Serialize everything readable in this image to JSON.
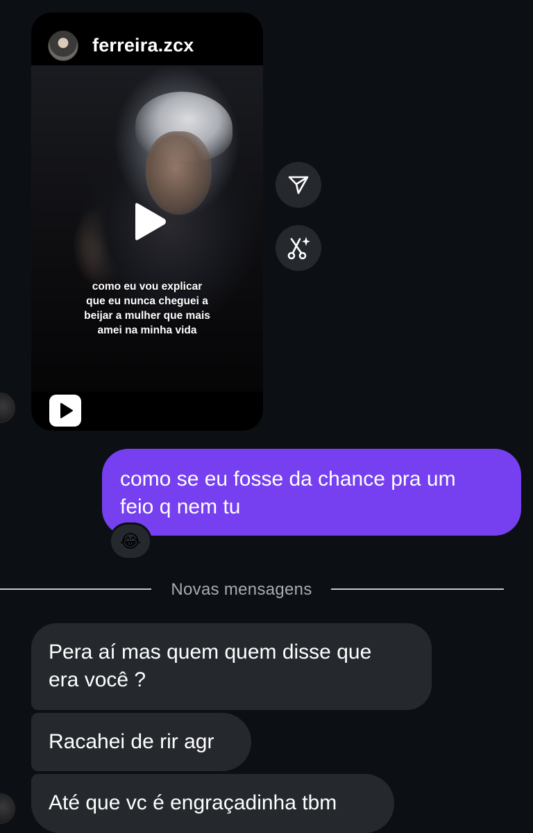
{
  "reel": {
    "username": "ferreira.zcx",
    "caption_lines": [
      "como eu vou explicar",
      "que eu nunca cheguei a",
      "beijar a mulher que mais",
      "amei na minha vida"
    ],
    "avatar_icon": "profile-photo",
    "play_icon": "play-icon",
    "reels_icon": "reels-icon"
  },
  "actions": {
    "share_icon": "send-icon",
    "remix_icon": "scissors-sparkle-icon"
  },
  "sent_message": {
    "lines": [
      "como se eu fosse da chance pra um",
      "feio q nem tu"
    ],
    "reaction": "😂",
    "color": "#7640f0"
  },
  "divider": {
    "label": "Novas mensagens"
  },
  "received_messages": [
    {
      "lines": [
        "Pera aí mas quem quem disse que",
        "era você ?"
      ]
    },
    {
      "lines": [
        "Racahei de rir agr"
      ]
    },
    {
      "lines": [
        "Até que vc é engraçadinha tbm"
      ]
    }
  ],
  "colors": {
    "background": "#0c1014",
    "received_bubble": "#25292e",
    "divider_text": "#a8abb0"
  }
}
